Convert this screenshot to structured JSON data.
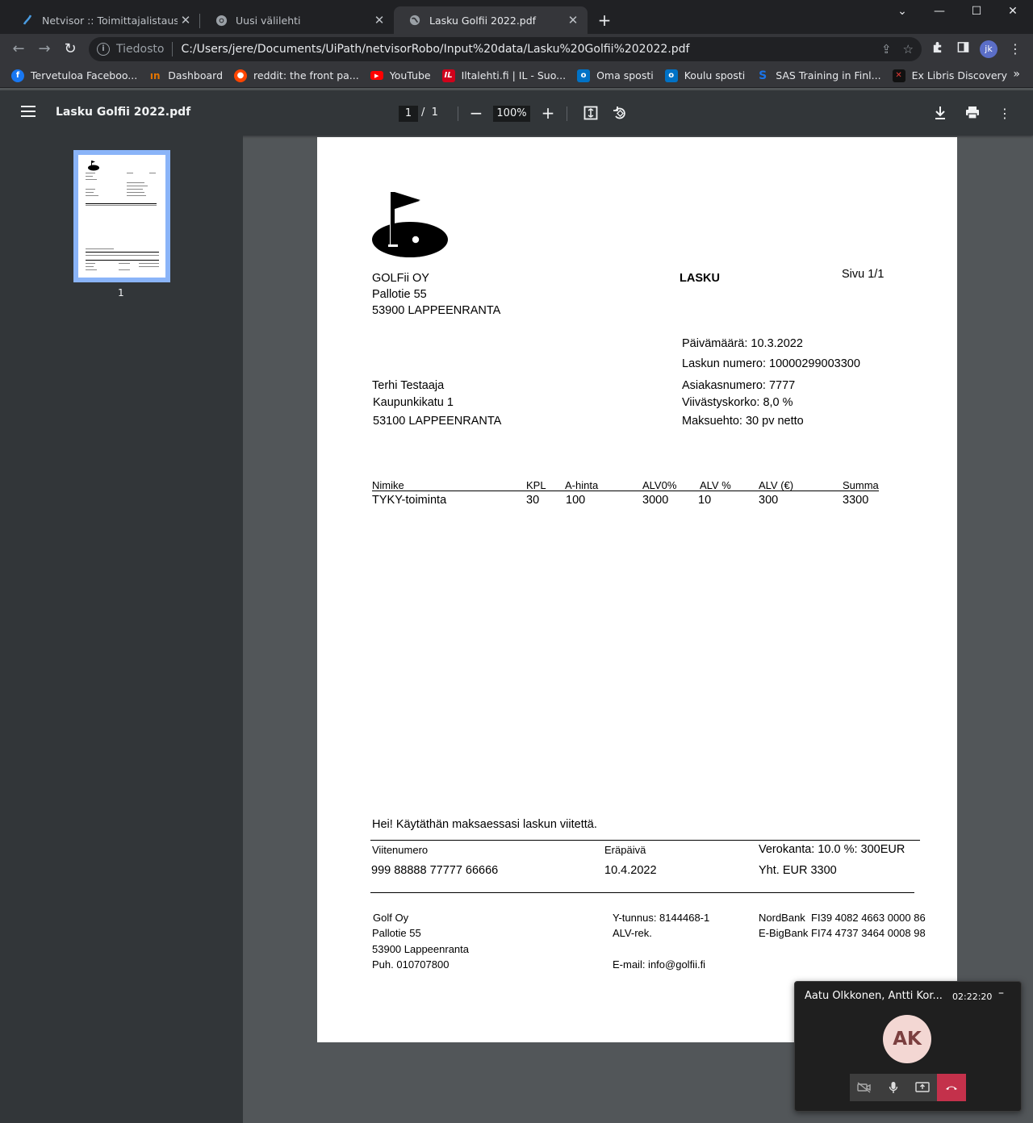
{
  "tabs": [
    {
      "title": "Netvisor :: Toimittajalistaus",
      "icon": "netvisor-icon",
      "active": false
    },
    {
      "title": "Uusi välilehti",
      "icon": "chrome-icon",
      "active": false
    },
    {
      "title": "Lasku Golfii 2022.pdf",
      "icon": "globe-icon",
      "active": true
    }
  ],
  "omnibox": {
    "scheme_label": "Tiedosto",
    "url": "C:/Users/jere/Documents/UiPath/netvisorRobo/Input%20data/Lasku%20Golfii%202022.pdf"
  },
  "profile": {
    "initials": "jk"
  },
  "bookmarks": [
    {
      "label": "Tervetuloa Faceboo...",
      "icon": "facebook-icon",
      "color": "#1877f2"
    },
    {
      "label": "Dashboard",
      "icon": "dashboard-icon",
      "color": "#e37400"
    },
    {
      "label": "reddit: the front pa...",
      "icon": "reddit-icon",
      "color": "#ff4500"
    },
    {
      "label": "YouTube",
      "icon": "youtube-icon",
      "color": "#ff0000"
    },
    {
      "label": "Iltalehti.fi | IL - Suo...",
      "icon": "iltalehti-icon",
      "color": "#d0021b"
    },
    {
      "label": "Oma sposti",
      "icon": "outlook-icon",
      "color": "#0072c6"
    },
    {
      "label": "Koulu sposti",
      "icon": "outlook-icon",
      "color": "#0072c6"
    },
    {
      "label": "SAS Training in Finl...",
      "icon": "sas-icon",
      "color": "#1a73e8"
    },
    {
      "label": "Ex Libris Discovery",
      "icon": "exlibris-icon",
      "color": "#111111"
    }
  ],
  "pdf_viewer": {
    "title": "Lasku Golfii 2022.pdf",
    "current_page": "1",
    "page_sep": "/",
    "total_pages": "1",
    "zoom": "100%",
    "thumbnail_label": "1"
  },
  "invoice": {
    "company": [
      "GOLFii OY",
      "Pallotie 55",
      "53900 LAPPEENRANTA"
    ],
    "doc_title": "LASKU",
    "page_info": "Sivu 1/1",
    "meta": [
      "Päivämäärä: 10.3.2022",
      "Laskun numero: 10000299003300",
      "Asiakasnumero: 7777",
      "Viivästyskorko: 8,0 %",
      "Maksuehto: 30 pv netto"
    ],
    "customer": [
      "Terhi Testaaja",
      "Kaupunkikatu 1",
      "53100 LAPPEENRANTA"
    ],
    "table_headers": [
      "Nimike",
      "KPL",
      "A-hinta",
      "ALV0%",
      "ALV %",
      "ALV (€)",
      "Summa"
    ],
    "table_rows": [
      [
        "TYKY-toiminta",
        "30",
        "100",
        "3000",
        "10",
        "300",
        "3300"
      ]
    ],
    "note": "Hei! Käytäthän maksaessasi laskun viitettä.",
    "payment": {
      "ref_label": "Viitenumero",
      "ref_value": "999 88888 77777 66666",
      "due_label": "Eräpäivä",
      "due_value": "10.4.2022",
      "tax_label": "Verokanta: 10.0 %: 300EUR",
      "total": "Yht. EUR 3300"
    },
    "footer": {
      "col1": [
        "Golf Oy",
        "Pallotie 55",
        "53900 Lappeenranta",
        "Puh. 010707800"
      ],
      "col2": [
        "Y-tunnus: 8144468-1",
        "ALV-rek.",
        "E-mail: info@golfii.fi"
      ],
      "col3": [
        "NordBank  FI39 4082 4663 0000 86",
        "E-BigBank FI74 4737 3464 0008 98"
      ]
    }
  },
  "call": {
    "participants": "Aatu Olkkonen, Antti Kor...",
    "duration": "02:22:20",
    "avatar_initials": "AK"
  }
}
